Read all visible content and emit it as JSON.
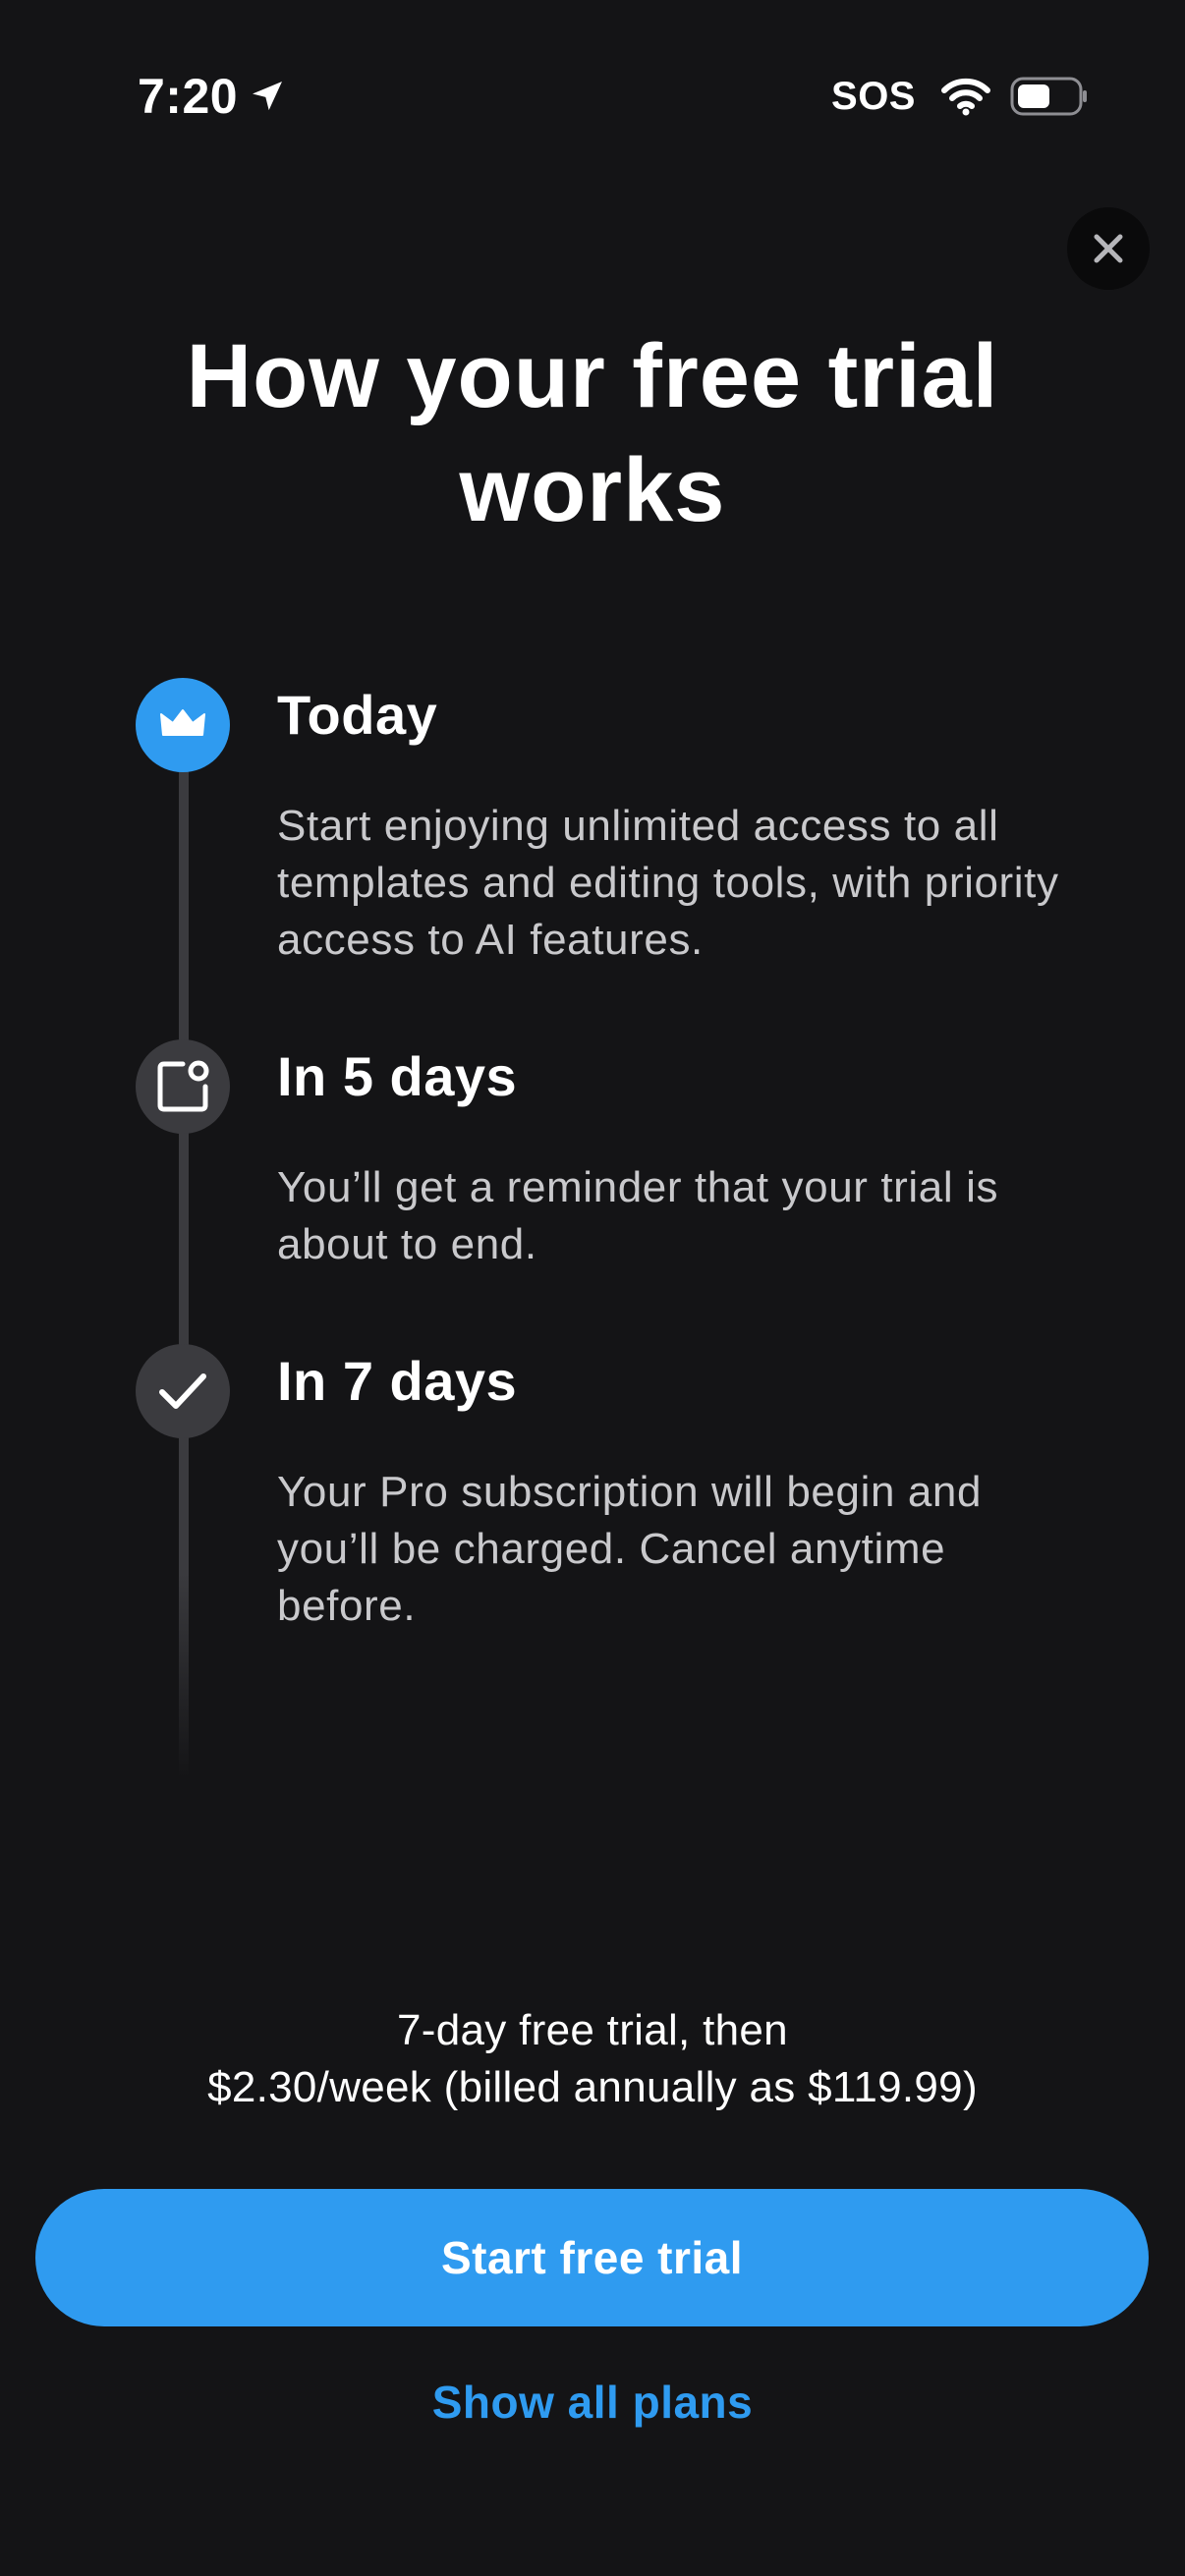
{
  "status_bar": {
    "time": "7:20",
    "sos": "SOS",
    "icons": [
      "location-arrow-icon",
      "wifi-icon",
      "battery-icon"
    ],
    "battery_level_fraction": 0.55
  },
  "close_button": {
    "icon": "close-icon"
  },
  "title": "How your free trial works",
  "timeline": [
    {
      "icon": "crown-icon",
      "title": "Today",
      "description": "Start enjoying unlimited access to all templates and editing tools, with priority access to AI features.",
      "active": true
    },
    {
      "icon": "notification-icon",
      "title": "In 5 days",
      "description": "You’ll get a reminder that your trial is about to end.",
      "active": false
    },
    {
      "icon": "checkmark-icon",
      "title": "In 7 days",
      "description": "Your Pro subscription will begin and you’ll be charged. Cancel anytime before.",
      "active": false
    }
  ],
  "pricing": {
    "line1": "7-day free trial, then",
    "line2": "$2.30/week (billed annually as $119.99)"
  },
  "cta": {
    "primary_label": "Start free trial",
    "secondary_label": "Show all plans"
  },
  "colors": {
    "background": "#141416",
    "accent": "#2f9bf0",
    "inactive_step": "#3b3b3f",
    "secondary_text": "#c9c9cc"
  }
}
